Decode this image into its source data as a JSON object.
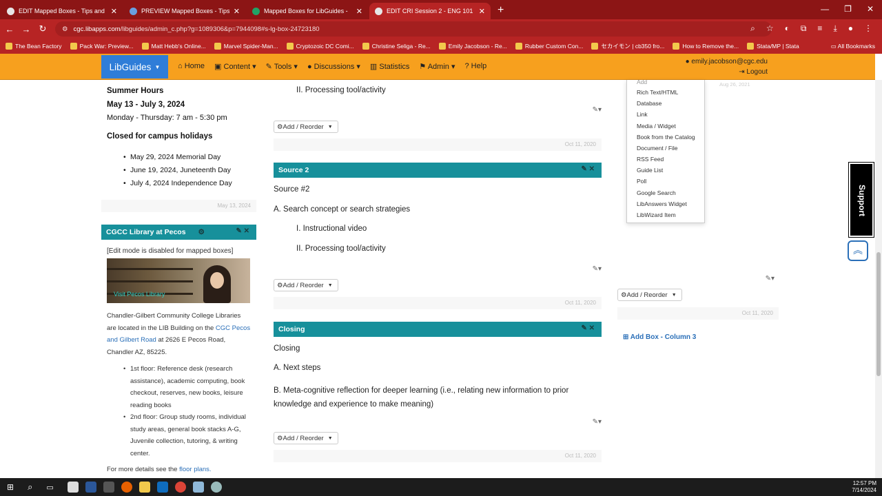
{
  "browser": {
    "tabs": [
      {
        "label": "EDIT Mapped Boxes - Tips and",
        "favicon_color": "#e6e6e6",
        "active": false
      },
      {
        "label": "PREVIEW Mapped Boxes - Tips",
        "favicon_color": "#6a9fe0",
        "active": false
      },
      {
        "label": "Mapped Boxes for LibGuides -",
        "favicon_color": "#21a366",
        "active": false
      },
      {
        "label": "EDIT CRI Session 2 - ENG 101 -",
        "favicon_color": "#e6e6e6",
        "active": true
      }
    ],
    "url_host": "cgc.libapps.com",
    "url_path": "/libguides/admin_c.php?g=1089306&p=7944098#s-lg-box-24723180",
    "bookmarks": [
      "The Bean Factory",
      "Pack War: Preview...",
      "Matt Hebb's Online...",
      "Marvel Spider-Man...",
      "Cryptozoic DC Comi...",
      "Christine Seliga - Re...",
      "Emily Jacobson - Re...",
      "Rubber Custom Con...",
      "セカイモン | cb350 fro...",
      "How to Remove the...",
      "Stata/MP | Stata"
    ],
    "all_bookmarks": "All Bookmarks"
  },
  "nav": {
    "brand": "LibGuides",
    "items": [
      "Home",
      "Content",
      "Tools",
      "Discussions",
      "Statistics",
      "Admin",
      "Help"
    ],
    "user_email": "emily.jacobson@cgc.edu",
    "logout": "Logout"
  },
  "left": {
    "summer_title": "Summer Hours",
    "summer_dates": "May 13 - July 3, 2024",
    "summer_days": "Monday - Thursday: 7 am - 5:30 pm",
    "closed_title": "Closed for campus holidays",
    "holidays": [
      "May 29, 2024 Memorial Day",
      "June 19, 2024, Juneteenth Day",
      "July 4, 2024 Independence Day"
    ],
    "hours_date": "May 13, 2024",
    "pecos_title": "CGCC Library at Pecos",
    "edit_disabled": "[Edit mode is disabled for mapped boxes]",
    "image_caption": "Visit Pecos Library",
    "pecos_text_1": "Chandler-Gilbert Community College Libraries are located in the LIB Building on the ",
    "pecos_link": "CGC Pecos and Gilbert Road",
    "pecos_text_2": " at 2626 E Pecos Road, Chandler AZ, 85225.",
    "floors": [
      "1st floor: Reference desk (research assistance), academic computing, book checkout, reserves, new books, leisure reading books",
      "2nd floor: Group study rooms, individual study areas, general book stacks A-G, Juvenile collection, tutoring, & writing center."
    ],
    "more_details": "For more details see the ",
    "floor_plans": "floor plans."
  },
  "center": {
    "top_item": "II. Processing tool/activity",
    "add_reorder": "Add / Reorder",
    "date": "Oct 11, 2020",
    "source2_title": "Source 2",
    "source2_heading": "Source #2",
    "source2_a": "A. Search concept or search strategies",
    "source2_i": "I. Instructional video",
    "source2_ii": "II. Processing tool/activity",
    "closing_title": "Closing",
    "closing_heading": "Closing",
    "closing_a": "A. Next steps",
    "closing_b": "B. Meta-cognitive reflection for deeper learning (i.e., relating new information to prior knowledge and experience to make meaning)"
  },
  "right": {
    "dropdown_items": [
      "Add",
      "Rich Text/HTML",
      "Database",
      "Link",
      "Media / Widget",
      "Book from the Catalog",
      "Document / File",
      "RSS Feed",
      "Guide List",
      "Poll",
      "Google Search",
      "LibAnswers Widget",
      "LibWizard Item"
    ],
    "faded_date": "Aug 26, 2021",
    "add_reorder": "Add / Reorder",
    "date": "Oct 11, 2020",
    "add_box": "Add Box - Column 3",
    "support": "Support"
  },
  "taskbar": {
    "time": "12:57 PM",
    "date": "7/14/2024"
  },
  "colors": {
    "browser_red": "#b72424",
    "nav_orange": "#f7a01e",
    "brand_blue": "#2f7dd8",
    "box_teal": "#17909b"
  }
}
